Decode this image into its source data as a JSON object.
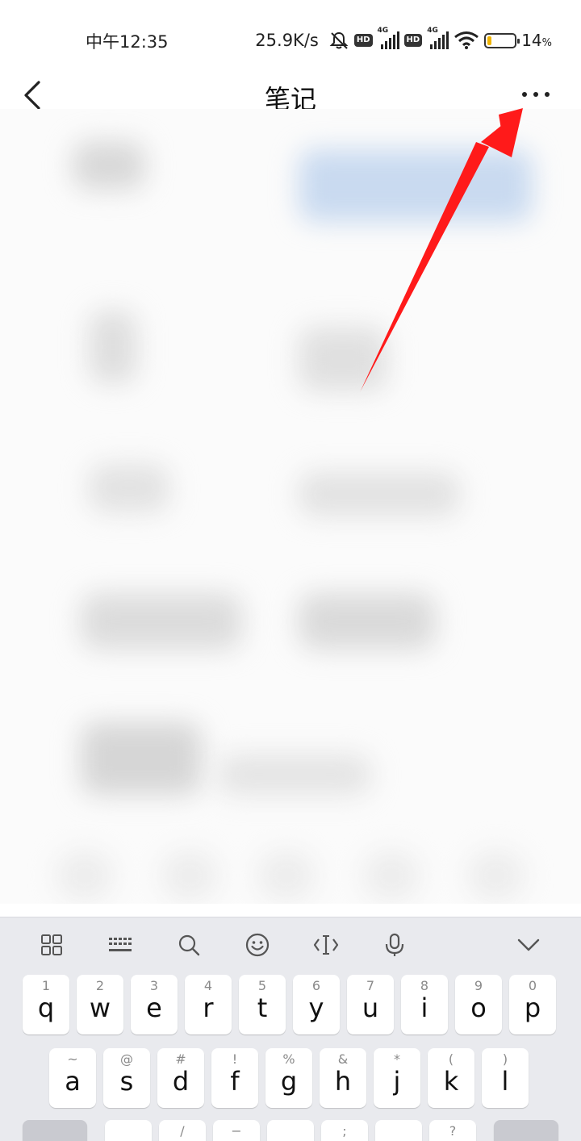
{
  "status_bar": {
    "time": "中午12:35",
    "net_speed": "25.9K/s",
    "hd_label": "HD",
    "network_label": "4G",
    "battery_percent": "14",
    "battery_unit": "%",
    "battery_level": 0.14,
    "icons": [
      "mute-icon",
      "signal-icon",
      "wifi-icon",
      "battery-icon"
    ]
  },
  "nav": {
    "title": "笔记",
    "back_icon": "chevron-left-icon",
    "more_icon": "more-dots-icon"
  },
  "annotation": {
    "arrow_color": "#ff1a1a"
  },
  "keyboard": {
    "toolbar": [
      "grid-icon",
      "keyboard-icon",
      "search-icon",
      "emoji-icon",
      "cursor-icon",
      "microphone-icon",
      "collapse-icon"
    ],
    "row1": [
      {
        "hint": "1",
        "ch": "q"
      },
      {
        "hint": "2",
        "ch": "w"
      },
      {
        "hint": "3",
        "ch": "e"
      },
      {
        "hint": "4",
        "ch": "r"
      },
      {
        "hint": "5",
        "ch": "t"
      },
      {
        "hint": "6",
        "ch": "y"
      },
      {
        "hint": "7",
        "ch": "u"
      },
      {
        "hint": "8",
        "ch": "i"
      },
      {
        "hint": "9",
        "ch": "o"
      },
      {
        "hint": "0",
        "ch": "p"
      }
    ],
    "row2": [
      {
        "hint": "~",
        "ch": "a"
      },
      {
        "hint": "@",
        "ch": "s"
      },
      {
        "hint": "#",
        "ch": "d"
      },
      {
        "hint": "!",
        "ch": "f"
      },
      {
        "hint": "%",
        "ch": "g"
      },
      {
        "hint": "&",
        "ch": "h"
      },
      {
        "hint": "*",
        "ch": "j"
      },
      {
        "hint": "(",
        "ch": "k"
      },
      {
        "hint": ")",
        "ch": "l"
      }
    ],
    "row3_hints": [
      "/",
      "−",
      ";",
      "?"
    ]
  }
}
